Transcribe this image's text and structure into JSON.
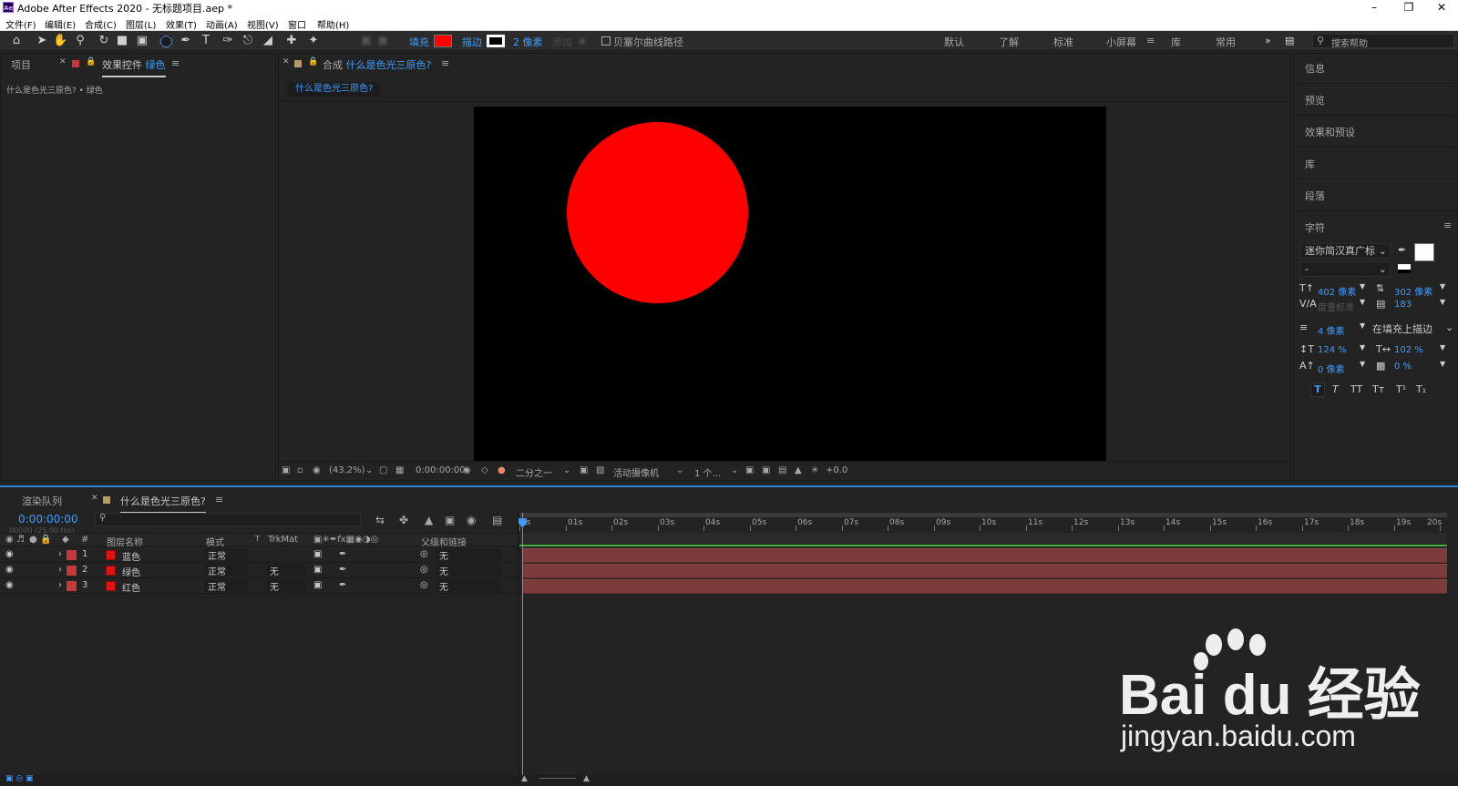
{
  "window": {
    "title": "Adobe After Effects 2020 - 无标题项目.aep *",
    "app_icon": "Ae"
  },
  "menu": [
    "文件(F)",
    "编辑(E)",
    "合成(C)",
    "图层(L)",
    "效果(T)",
    "动画(A)",
    "视图(V)",
    "窗口",
    "帮助(H)"
  ],
  "toolbar": {
    "fill_label": "填充",
    "fill_color": "#ff0000",
    "stroke_label": "描边",
    "stroke_width": "2 像素",
    "add_label": "添加",
    "bezier_label": "贝塞尔曲线路径",
    "workspaces": [
      "默认",
      "了解",
      "标准",
      "小屏幕",
      "库",
      "常用"
    ],
    "active_workspace": "小屏幕",
    "search_placeholder": "搜索帮助"
  },
  "left_panel": {
    "tabs": [
      "项目",
      "效果控件 绿色"
    ],
    "tab_project": "项目",
    "tab_effects_prefix": "效果控件",
    "tab_effects_layer": "绿色",
    "breadcrumb": "什么是色光三原色? • 绿色"
  },
  "comp_panel": {
    "tab_prefix": "合成",
    "tab_name": "什么是色光三原色?",
    "subtab": "什么是色光三原色?",
    "circle_color": "#ff0000",
    "viewer": {
      "zoom": "(43.2%)",
      "timecode": "0:00:00:00",
      "resolution": "二分之一",
      "camera": "活动摄像机",
      "views": "1 个...",
      "exposure": "+0.0"
    }
  },
  "right_panel": {
    "items": [
      "信息",
      "预览",
      "效果和预设",
      "库",
      "段落"
    ],
    "character": {
      "title": "字符",
      "font": "迷你简汉真广标",
      "style": "-",
      "size": "402 像素",
      "leading": "302 像素",
      "kerning": "度量标准",
      "tracking": "183",
      "stroke_width": "4 像素",
      "stroke_mode": "在填充上描边",
      "vscale": "124 %",
      "hscale": "102 %",
      "baseline": "0 像素",
      "tsume": "0 %",
      "style_buttons": [
        "T",
        "T",
        "TT",
        "Tт",
        "T¹",
        "T₁"
      ]
    }
  },
  "timeline": {
    "tabs": [
      "渲染队列",
      "什么是色光三原色?"
    ],
    "tab_render": "渲染队列",
    "tab_comp": "什么是色光三原色?",
    "timecode": "0:00:00:00",
    "frame_info": "00000 (25.00 fps)",
    "columns": {
      "hash": "#",
      "name": "图层名称",
      "mode": "模式",
      "t": "T",
      "trkmat": "TrkMat",
      "parent": "父级和链接"
    },
    "layers": [
      {
        "num": "1",
        "name": "蓝色",
        "mode": "正常",
        "trkmat": "",
        "parent": "无"
      },
      {
        "num": "2",
        "name": "绿色",
        "mode": "正常",
        "trkmat": "无",
        "parent": "无"
      },
      {
        "num": "3",
        "name": "红色",
        "mode": "正常",
        "trkmat": "无",
        "parent": "无"
      }
    ],
    "ruler": [
      "0s",
      "01s",
      "02s",
      "03s",
      "04s",
      "05s",
      "06s",
      "07s",
      "08s",
      "09s",
      "10s",
      "11s",
      "12s",
      "13s",
      "14s",
      "15s",
      "16s",
      "17s",
      "18s",
      "19s",
      "20s"
    ],
    "layer_bar_color": "#7c3b3b"
  },
  "watermark": {
    "brand": "Bai du 经验",
    "url": "jingyan.baidu.com"
  }
}
